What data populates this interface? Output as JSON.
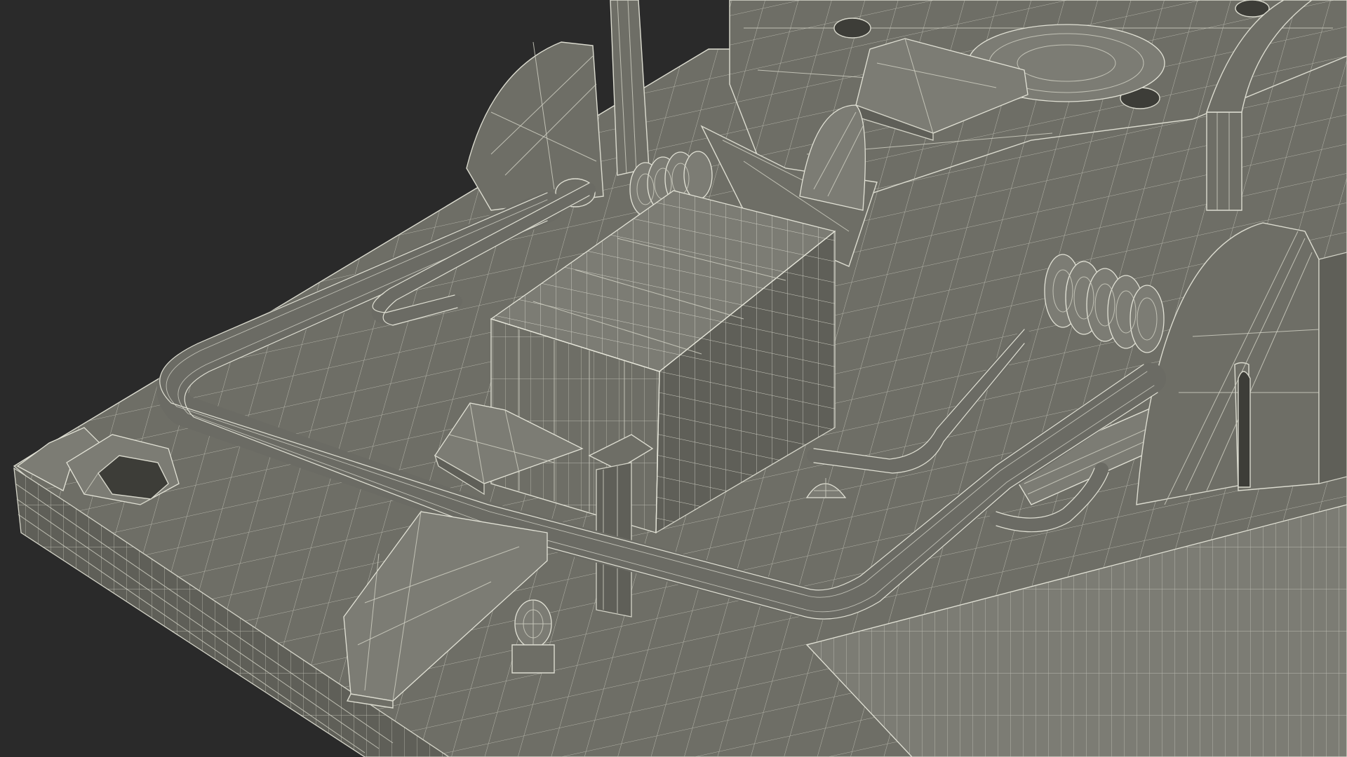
{
  "scene": {
    "subject": "mousetrap-wireframe",
    "colors": {
      "background": "#2a2a2a",
      "surface": "#6e6e66",
      "wire": "#dcdcd0",
      "hole": "#3d3d38"
    }
  }
}
